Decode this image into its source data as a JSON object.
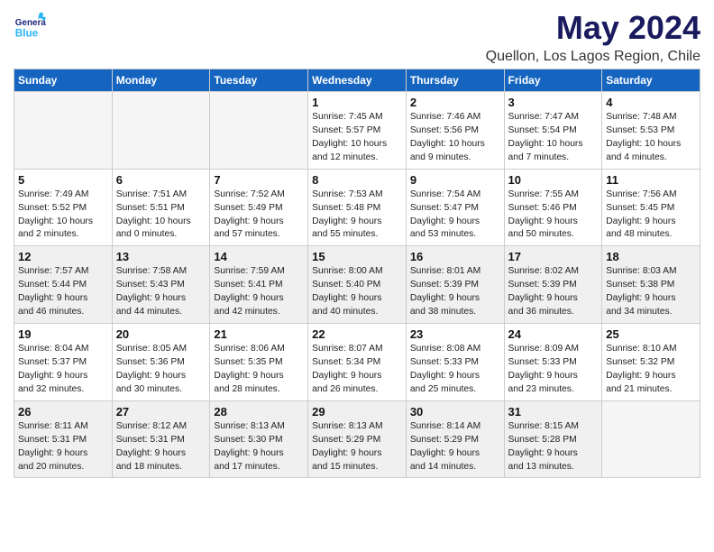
{
  "logo": {
    "general": "General",
    "blue": "Blue"
  },
  "title": "May 2024",
  "subtitle": "Quellon, Los Lagos Region, Chile",
  "headers": [
    "Sunday",
    "Monday",
    "Tuesday",
    "Wednesday",
    "Thursday",
    "Friday",
    "Saturday"
  ],
  "weeks": [
    [
      {
        "day": "",
        "empty": true
      },
      {
        "day": "",
        "empty": true
      },
      {
        "day": "",
        "empty": true
      },
      {
        "day": "1",
        "info": "Sunrise: 7:45 AM\nSunset: 5:57 PM\nDaylight: 10 hours\nand 12 minutes."
      },
      {
        "day": "2",
        "info": "Sunrise: 7:46 AM\nSunset: 5:56 PM\nDaylight: 10 hours\nand 9 minutes."
      },
      {
        "day": "3",
        "info": "Sunrise: 7:47 AM\nSunset: 5:54 PM\nDaylight: 10 hours\nand 7 minutes."
      },
      {
        "day": "4",
        "info": "Sunrise: 7:48 AM\nSunset: 5:53 PM\nDaylight: 10 hours\nand 4 minutes."
      }
    ],
    [
      {
        "day": "5",
        "info": "Sunrise: 7:49 AM\nSunset: 5:52 PM\nDaylight: 10 hours\nand 2 minutes."
      },
      {
        "day": "6",
        "info": "Sunrise: 7:51 AM\nSunset: 5:51 PM\nDaylight: 10 hours\nand 0 minutes."
      },
      {
        "day": "7",
        "info": "Sunrise: 7:52 AM\nSunset: 5:49 PM\nDaylight: 9 hours\nand 57 minutes."
      },
      {
        "day": "8",
        "info": "Sunrise: 7:53 AM\nSunset: 5:48 PM\nDaylight: 9 hours\nand 55 minutes."
      },
      {
        "day": "9",
        "info": "Sunrise: 7:54 AM\nSunset: 5:47 PM\nDaylight: 9 hours\nand 53 minutes."
      },
      {
        "day": "10",
        "info": "Sunrise: 7:55 AM\nSunset: 5:46 PM\nDaylight: 9 hours\nand 50 minutes."
      },
      {
        "day": "11",
        "info": "Sunrise: 7:56 AM\nSunset: 5:45 PM\nDaylight: 9 hours\nand 48 minutes."
      }
    ],
    [
      {
        "day": "12",
        "info": "Sunrise: 7:57 AM\nSunset: 5:44 PM\nDaylight: 9 hours\nand 46 minutes."
      },
      {
        "day": "13",
        "info": "Sunrise: 7:58 AM\nSunset: 5:43 PM\nDaylight: 9 hours\nand 44 minutes."
      },
      {
        "day": "14",
        "info": "Sunrise: 7:59 AM\nSunset: 5:41 PM\nDaylight: 9 hours\nand 42 minutes."
      },
      {
        "day": "15",
        "info": "Sunrise: 8:00 AM\nSunset: 5:40 PM\nDaylight: 9 hours\nand 40 minutes."
      },
      {
        "day": "16",
        "info": "Sunrise: 8:01 AM\nSunset: 5:39 PM\nDaylight: 9 hours\nand 38 minutes."
      },
      {
        "day": "17",
        "info": "Sunrise: 8:02 AM\nSunset: 5:39 PM\nDaylight: 9 hours\nand 36 minutes."
      },
      {
        "day": "18",
        "info": "Sunrise: 8:03 AM\nSunset: 5:38 PM\nDaylight: 9 hours\nand 34 minutes."
      }
    ],
    [
      {
        "day": "19",
        "info": "Sunrise: 8:04 AM\nSunset: 5:37 PM\nDaylight: 9 hours\nand 32 minutes."
      },
      {
        "day": "20",
        "info": "Sunrise: 8:05 AM\nSunset: 5:36 PM\nDaylight: 9 hours\nand 30 minutes."
      },
      {
        "day": "21",
        "info": "Sunrise: 8:06 AM\nSunset: 5:35 PM\nDaylight: 9 hours\nand 28 minutes."
      },
      {
        "day": "22",
        "info": "Sunrise: 8:07 AM\nSunset: 5:34 PM\nDaylight: 9 hours\nand 26 minutes."
      },
      {
        "day": "23",
        "info": "Sunrise: 8:08 AM\nSunset: 5:33 PM\nDaylight: 9 hours\nand 25 minutes."
      },
      {
        "day": "24",
        "info": "Sunrise: 8:09 AM\nSunset: 5:33 PM\nDaylight: 9 hours\nand 23 minutes."
      },
      {
        "day": "25",
        "info": "Sunrise: 8:10 AM\nSunset: 5:32 PM\nDaylight: 9 hours\nand 21 minutes."
      }
    ],
    [
      {
        "day": "26",
        "info": "Sunrise: 8:11 AM\nSunset: 5:31 PM\nDaylight: 9 hours\nand 20 minutes."
      },
      {
        "day": "27",
        "info": "Sunrise: 8:12 AM\nSunset: 5:31 PM\nDaylight: 9 hours\nand 18 minutes."
      },
      {
        "day": "28",
        "info": "Sunrise: 8:13 AM\nSunset: 5:30 PM\nDaylight: 9 hours\nand 17 minutes."
      },
      {
        "day": "29",
        "info": "Sunrise: 8:13 AM\nSunset: 5:29 PM\nDaylight: 9 hours\nand 15 minutes."
      },
      {
        "day": "30",
        "info": "Sunrise: 8:14 AM\nSunset: 5:29 PM\nDaylight: 9 hours\nand 14 minutes."
      },
      {
        "day": "31",
        "info": "Sunrise: 8:15 AM\nSunset: 5:28 PM\nDaylight: 9 hours\nand 13 minutes."
      },
      {
        "day": "",
        "empty": true
      }
    ]
  ]
}
